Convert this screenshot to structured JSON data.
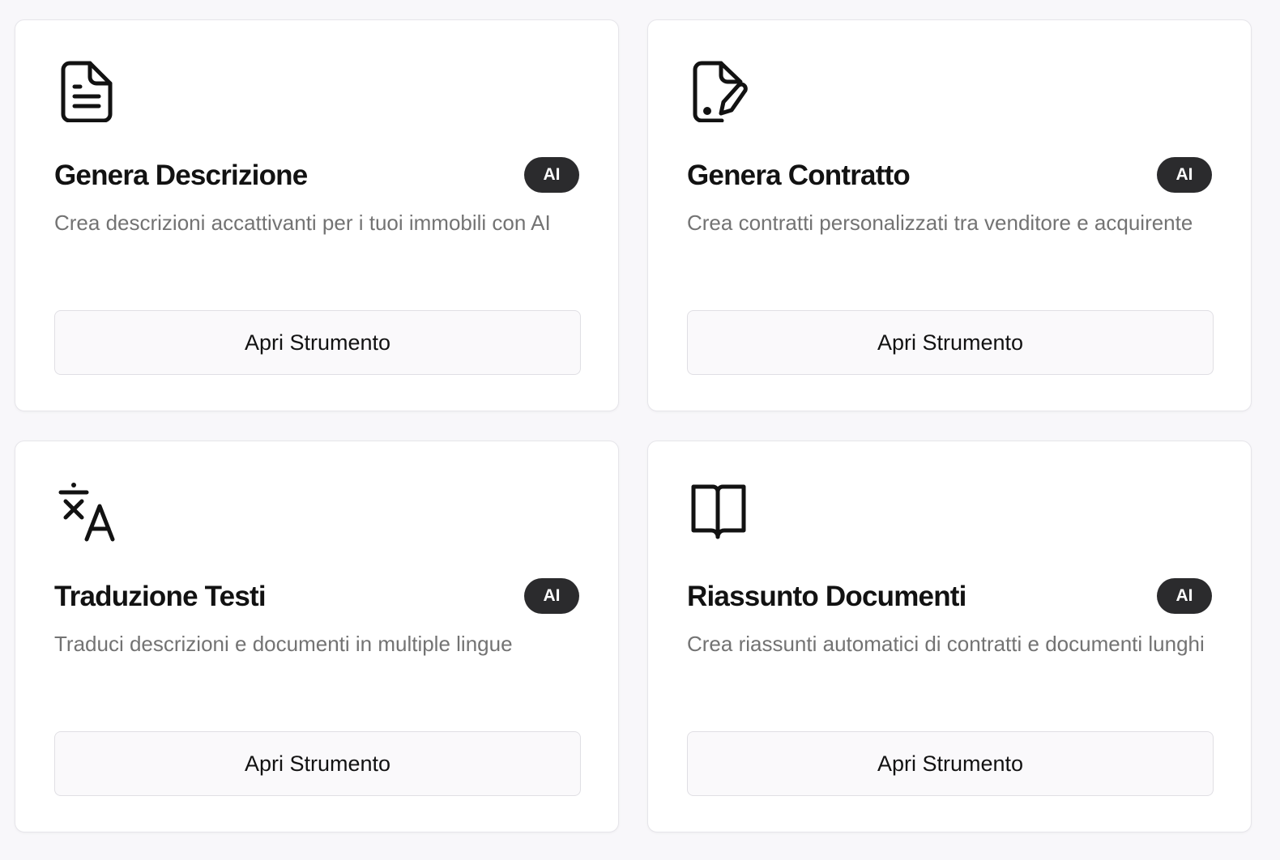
{
  "tools": [
    {
      "icon": "file-text-icon",
      "title": "Genera Descrizione",
      "badge": "AI",
      "description": "Crea descrizioni accattivanti per i tuoi immobili con AI",
      "button_label": "Apri Strumento"
    },
    {
      "icon": "file-signature-icon",
      "title": "Genera Contratto",
      "badge": "AI",
      "description": "Crea contratti personalizzati tra venditore e acquirente",
      "button_label": "Apri Strumento"
    },
    {
      "icon": "translate-icon",
      "title": "Traduzione Testi",
      "badge": "AI",
      "description": "Traduci descrizioni e documenti in multiple lingue",
      "button_label": "Apri Strumento"
    },
    {
      "icon": "book-open-icon",
      "title": "Riassunto Documenti",
      "badge": "AI",
      "description": "Crea riassunti automatici di contratti e documenti lunghi",
      "button_label": "Apri Strumento"
    }
  ],
  "colors": {
    "background": "#f8f7fa",
    "card": "#ffffff",
    "badge": "#2b2b2d",
    "text": "#121212",
    "muted": "#737373"
  }
}
